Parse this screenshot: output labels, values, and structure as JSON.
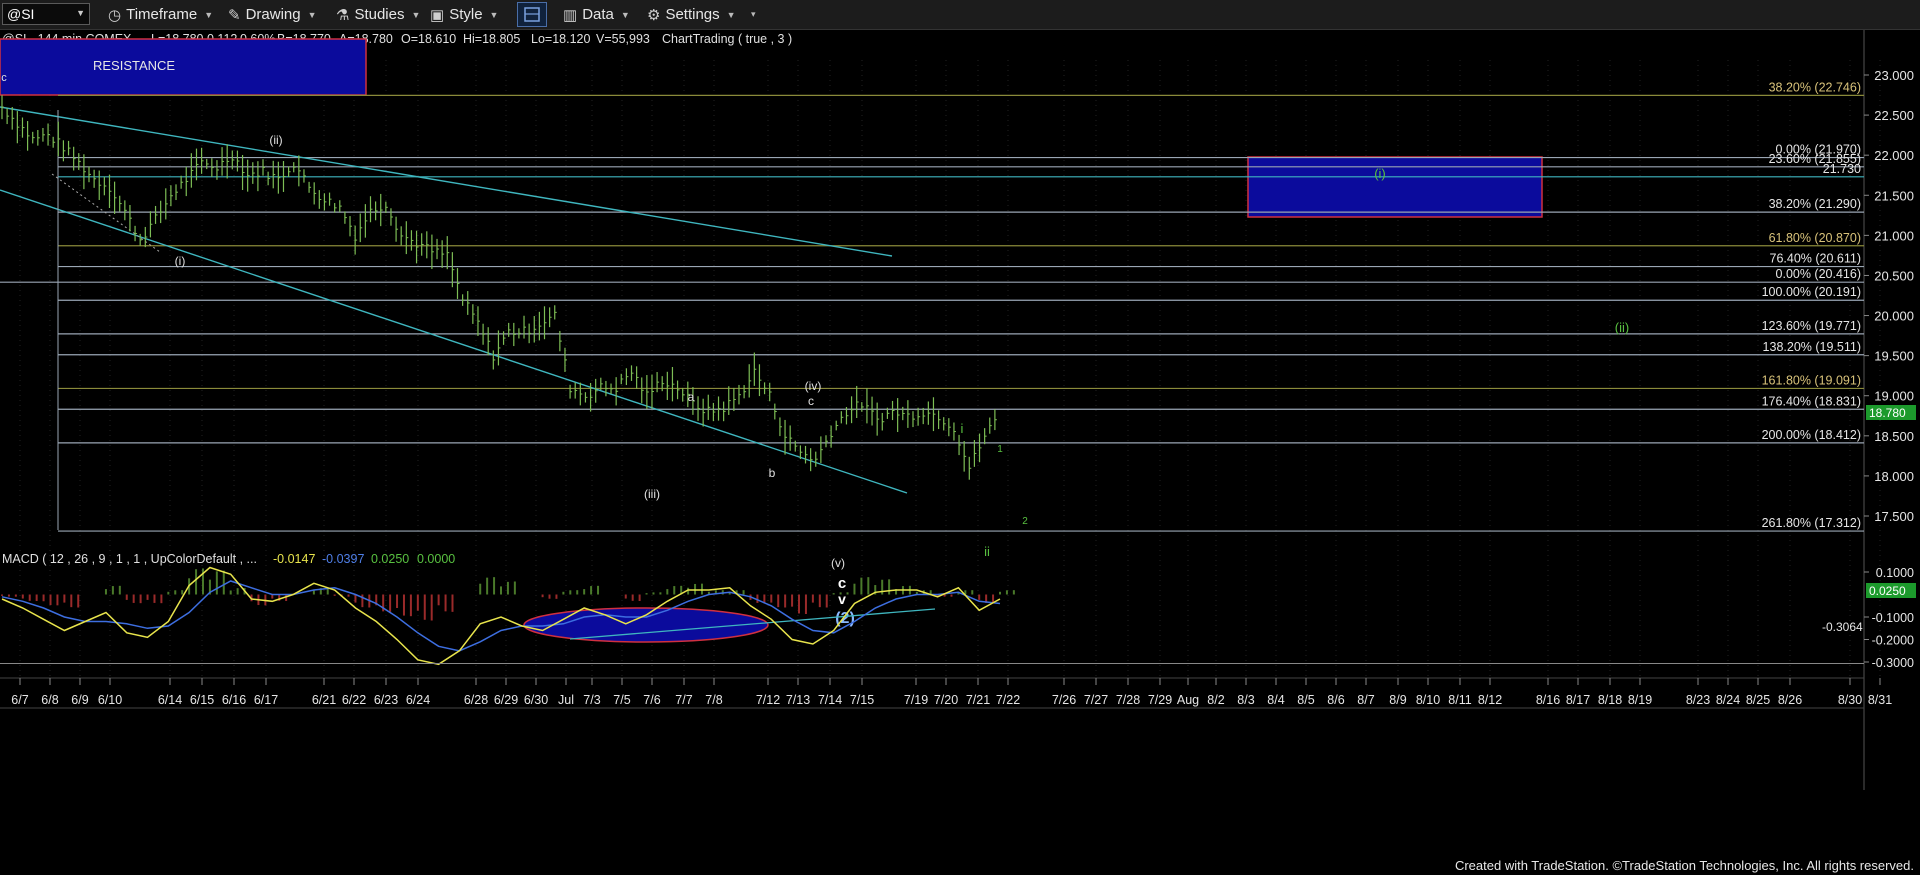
{
  "toolbar": {
    "symbol": "@SI",
    "items": [
      {
        "label": "Timeframe",
        "icon": "clock-icon"
      },
      {
        "label": "Drawing",
        "icon": "pencil-icon"
      },
      {
        "label": "Studies",
        "icon": "flask-icon"
      },
      {
        "label": "Style",
        "icon": "style-icon"
      },
      {
        "label": "Data",
        "icon": "bar-chart-icon"
      },
      {
        "label": "Settings",
        "icon": "gear-icon"
      }
    ]
  },
  "header": {
    "symbol_info": "@SI - 144 min  COMEX",
    "last": "L=18.780",
    "change": "0.112",
    "change_pct": "0.60%",
    "bid": "B=18.770",
    "ask": "A=18.780",
    "open": "O=18.610",
    "high": "Hi=18.805",
    "low": "Lo=18.120",
    "volume": "V=55,993",
    "study": "ChartTrading ( true , 3 )"
  },
  "macd_header": {
    "label": "MACD ( 12 , 26 , 9 , 1 , 1 , UpColorDefault , ...",
    "macd_value": "-0.0147",
    "signal_value": "-0.0397",
    "hist_value": "0.0250",
    "zero_value": "0.0000"
  },
  "colors": {
    "background": "#000000",
    "price_bars": "#7dbd55",
    "trendline": "#3fb6bf",
    "fib_line": "#9aa6b4",
    "resistance_box": "#0a0a9a",
    "box_border": "#e03040",
    "macd_line": "#e8e44c",
    "signal_line": "#3d6ee0",
    "hist_up": "#4a7a2a",
    "hist_down": "#9a2a2a",
    "price_marker": "#1c9a2c"
  },
  "chart_data": {
    "type": "line",
    "title": "@SI - 144 min COMEX",
    "y_axis": {
      "ticks": [
        "23.000",
        "22.500",
        "22.000",
        "21.500",
        "21.000",
        "20.500",
        "20.000",
        "19.500",
        "19.000",
        "18.500",
        "18.000",
        "17.500"
      ],
      "ylim": [
        17.3,
        23.2
      ]
    },
    "x_axis": {
      "ticks": [
        "6/7",
        "6/8",
        "6/9",
        "6/10",
        "6/14",
        "6/15",
        "6/16",
        "6/17",
        "6/21",
        "6/22",
        "6/23",
        "6/24",
        "6/28",
        "6/29",
        "6/30",
        "Jul",
        "7/3",
        "7/5",
        "7/6",
        "7/7",
        "7/8",
        "7/12",
        "7/13",
        "7/14",
        "7/15",
        "7/19",
        "7/20",
        "7/21",
        "7/22",
        "7/26",
        "7/27",
        "7/28",
        "7/29",
        "Aug",
        "8/2",
        "8/3",
        "8/4",
        "8/5",
        "8/6",
        "8/7",
        "8/9",
        "8/10",
        "8/11",
        "8/12",
        "8/16",
        "8/17",
        "8/18",
        "8/19",
        "8/23",
        "8/24",
        "8/25",
        "8/26",
        "8/30",
        "8/31"
      ]
    },
    "series": [
      {
        "values": [
          22.6,
          22.4,
          22.2,
          22.25,
          22.1,
          21.9,
          21.7,
          21.6,
          21.3,
          20.95,
          21.2,
          21.5,
          21.7,
          21.9,
          21.85,
          22.0,
          21.75,
          21.8,
          21.7,
          21.9,
          21.6,
          21.45,
          21.35,
          21.0,
          21.3,
          21.4,
          21.0,
          20.9,
          20.8,
          20.75,
          20.2,
          19.9,
          19.5,
          19.8,
          19.8,
          19.9,
          20.0,
          19.1,
          19.0,
          19.1,
          19.1,
          19.3,
          19.0,
          19.2,
          19.1,
          18.9,
          18.8,
          18.85,
          19.0,
          19.3,
          19.0,
          18.5,
          18.3,
          18.2,
          18.55,
          18.8,
          18.9,
          18.7,
          18.8,
          18.75,
          18.8,
          18.75,
          18.6,
          18.1,
          18.5,
          18.78
        ]
      }
    ],
    "current_price": "18.780",
    "fib_levels": [
      {
        "label": "38.20% (22.746)",
        "value": 22.746
      },
      {
        "label": "0.00% (21.970)",
        "value": 21.97
      },
      {
        "label": "23.60% (21.855)",
        "value": 21.855
      },
      {
        "label": "21.730",
        "value": 21.73
      },
      {
        "label": "38.20% (21.290)",
        "value": 21.29
      },
      {
        "label": "61.80% (20.870)",
        "value": 20.87
      },
      {
        "label": "76.40% (20.611)",
        "value": 20.611
      },
      {
        "label": "0.00% (20.416)",
        "value": 20.416
      },
      {
        "label": "100.00% (20.191)",
        "value": 20.191
      },
      {
        "label": "123.60% (19.771)",
        "value": 19.771
      },
      {
        "label": "138.20% (19.511)",
        "value": 19.511
      },
      {
        "label": "161.80% (19.091)",
        "value": 19.091
      },
      {
        "label": "176.40% (18.831)",
        "value": 18.831
      },
      {
        "label": "200.00% (18.412)",
        "value": 18.412
      },
      {
        "label": "261.80% (17.312)",
        "value": 17.312
      }
    ],
    "resistance_label": "RESISTANCE",
    "wave_labels": [
      "c",
      "(ii)",
      "(i)",
      "(iii)",
      "a",
      "b",
      "(iv)",
      "c",
      "(v)",
      "c",
      "v",
      "(2)",
      "i",
      "ii",
      "1",
      "2",
      "(i)",
      "(ii)"
    ],
    "macd": {
      "y_ticks": [
        "0.1000",
        "0.0250",
        "-0.1000",
        "-0.2000",
        "-0.3000"
      ],
      "ylim": [
        -0.33,
        0.14
      ],
      "min_marker": "-0.3064",
      "macd_values": [
        -0.02,
        -0.06,
        -0.11,
        -0.16,
        -0.12,
        -0.08,
        -0.17,
        -0.19,
        -0.12,
        0.04,
        0.12,
        0.09,
        -0.02,
        -0.03,
        0.0,
        0.05,
        0.02,
        -0.06,
        -0.12,
        -0.2,
        -0.29,
        -0.31,
        -0.25,
        -0.13,
        -0.1,
        -0.14,
        -0.16,
        -0.11,
        -0.06,
        -0.09,
        -0.13,
        -0.09,
        -0.03,
        0.02,
        0.02,
        0.03,
        -0.05,
        -0.11,
        -0.2,
        -0.22,
        -0.16,
        -0.04,
        0.01,
        0.02,
        0.02,
        -0.01,
        0.03,
        -0.07,
        -0.02
      ],
      "signal_values": [
        -0.01,
        -0.03,
        -0.06,
        -0.1,
        -0.12,
        -0.12,
        -0.13,
        -0.15,
        -0.14,
        -0.08,
        0.01,
        0.06,
        0.03,
        0.0,
        0.0,
        0.02,
        0.03,
        0.0,
        -0.04,
        -0.1,
        -0.17,
        -0.23,
        -0.25,
        -0.21,
        -0.16,
        -0.14,
        -0.14,
        -0.13,
        -0.1,
        -0.09,
        -0.1,
        -0.1,
        -0.07,
        -0.03,
        0.0,
        0.01,
        -0.01,
        -0.05,
        -0.11,
        -0.16,
        -0.17,
        -0.12,
        -0.06,
        -0.02,
        0.0,
        0.0,
        0.01,
        -0.03,
        -0.04
      ]
    }
  },
  "footer": "Created with TradeStation. ©TradeStation Technologies, Inc. All rights reserved."
}
